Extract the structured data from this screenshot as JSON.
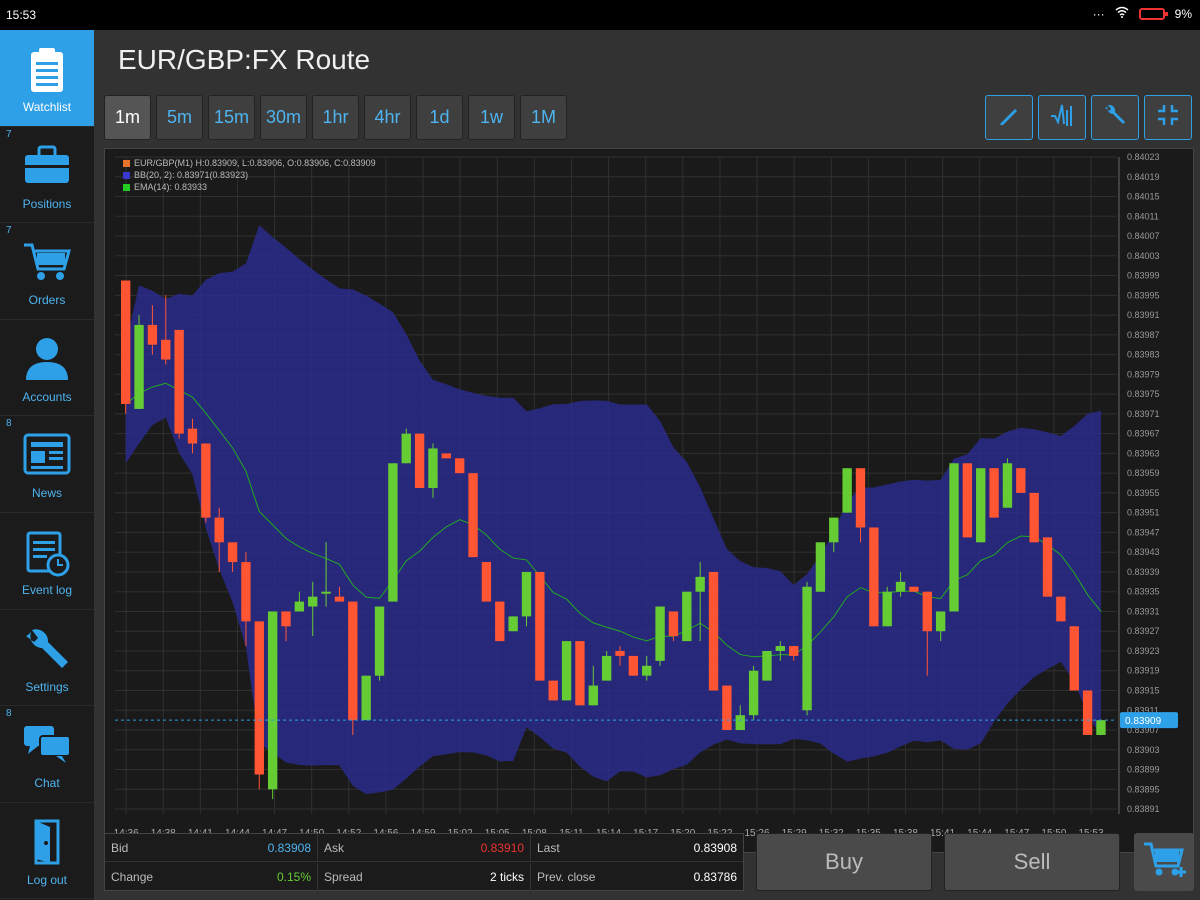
{
  "status_bar": {
    "time": "15:53",
    "battery": "9%"
  },
  "sidebar": {
    "items": [
      {
        "label": "Watchlist",
        "icon": "clipboard-icon",
        "badge": "",
        "active": true
      },
      {
        "label": "Positions",
        "icon": "briefcase-icon",
        "badge": "7",
        "active": false
      },
      {
        "label": "Orders",
        "icon": "cart-icon",
        "badge": "7",
        "active": false
      },
      {
        "label": "Accounts",
        "icon": "user-icon",
        "badge": "",
        "active": false
      },
      {
        "label": "News",
        "icon": "newspaper-icon",
        "badge": "8",
        "active": false
      },
      {
        "label": "Event log",
        "icon": "calendar-clock-icon",
        "badge": "",
        "active": false
      },
      {
        "label": "Settings",
        "icon": "wrench-icon",
        "badge": "",
        "active": false
      },
      {
        "label": "Chat",
        "icon": "chat-icon",
        "badge": "8",
        "active": false
      },
      {
        "label": "Log out",
        "icon": "logout-icon",
        "badge": "",
        "active": false
      }
    ]
  },
  "header": {
    "title": "EUR/GBP:FX Route"
  },
  "timeframes": [
    {
      "label": "1m",
      "active": true
    },
    {
      "label": "5m",
      "active": false
    },
    {
      "label": "15m",
      "active": false
    },
    {
      "label": "30m",
      "active": false
    },
    {
      "label": "1hr",
      "active": false
    },
    {
      "label": "4hr",
      "active": false
    },
    {
      "label": "1d",
      "active": false
    },
    {
      "label": "1w",
      "active": false
    },
    {
      "label": "1M",
      "active": false
    }
  ],
  "tools": [
    "pencil-icon",
    "indicator-icon",
    "wrench-icon",
    "fullscreen-icon"
  ],
  "chart_data": {
    "type": "candlestick",
    "legend": [
      {
        "text": "EUR/GBP(M1) H:0.83909, L:0.83906, O:0.83906, C:0.83909",
        "color": "#e8732a"
      },
      {
        "text": "BB(20, 2): 0.83971(0.83923)",
        "color": "#3838d0"
      },
      {
        "text": "EMA(14): 0.83933",
        "color": "#22cc22"
      }
    ],
    "ylim": [
      0.8389,
      0.84023
    ],
    "y_ticks": [
      "0.84023",
      "0.84019",
      "0.84015",
      "0.84011",
      "0.84007",
      "0.84003",
      "0.83999",
      "0.83995",
      "0.83991",
      "0.83987",
      "0.83983",
      "0.83979",
      "0.83975",
      "0.83971",
      "0.83967",
      "0.83963",
      "0.83959",
      "0.83955",
      "0.83951",
      "0.83947",
      "0.83943",
      "0.83939",
      "0.83935",
      "0.83931",
      "0.83927",
      "0.83923",
      "0.83919",
      "0.83915",
      "0.83911",
      "0.83907",
      "0.83903",
      "0.83899",
      "0.83895",
      "0.83891"
    ],
    "x_ticks": [
      "14:36",
      "14:38",
      "14:41",
      "14:44",
      "14:47",
      "14:50",
      "14:52",
      "14:56",
      "14:59",
      "15:02",
      "15:05",
      "15:08",
      "15:11",
      "15:14",
      "15:17",
      "15:20",
      "15:22",
      "15:26",
      "15:29",
      "15:32",
      "15:35",
      "15:38",
      "15:41",
      "15:44",
      "15:47",
      "15:50",
      "15:53"
    ],
    "last_price": "0.83909",
    "candles": [
      [
        0.83998,
        0.83998,
        0.83971,
        0.83973
      ],
      [
        0.83972,
        0.83991,
        0.83972,
        0.83989
      ],
      [
        0.83989,
        0.83993,
        0.83983,
        0.83985
      ],
      [
        0.83986,
        0.83995,
        0.83981,
        0.83982
      ],
      [
        0.83988,
        0.83988,
        0.83966,
        0.83967
      ],
      [
        0.83968,
        0.8397,
        0.83963,
        0.83965
      ],
      [
        0.83965,
        0.83965,
        0.83949,
        0.8395
      ],
      [
        0.8395,
        0.83952,
        0.83939,
        0.83945
      ],
      [
        0.83945,
        0.83945,
        0.83939,
        0.83941
      ],
      [
        0.83941,
        0.83943,
        0.83924,
        0.83929
      ],
      [
        0.83929,
        0.83929,
        0.83895,
        0.83898
      ],
      [
        0.83895,
        0.83931,
        0.83893,
        0.83931
      ],
      [
        0.83931,
        0.83931,
        0.83925,
        0.83928
      ],
      [
        0.83931,
        0.83935,
        0.83931,
        0.83933
      ],
      [
        0.83932,
        0.83937,
        0.83926,
        0.83934
      ],
      [
        0.83935,
        0.83945,
        0.83932,
        0.83935
      ],
      [
        0.83934,
        0.83936,
        0.83933,
        0.83933
      ],
      [
        0.83933,
        0.83933,
        0.83906,
        0.83909
      ],
      [
        0.83909,
        0.83918,
        0.83909,
        0.83918
      ],
      [
        0.83918,
        0.83932,
        0.83917,
        0.83932
      ],
      [
        0.83933,
        0.83961,
        0.83933,
        0.83961
      ],
      [
        0.83961,
        0.83968,
        0.83961,
        0.83967
      ],
      [
        0.83967,
        0.83965,
        0.83956,
        0.83956
      ],
      [
        0.83956,
        0.83965,
        0.83954,
        0.83964
      ],
      [
        0.83963,
        0.83963,
        0.83963,
        0.83962
      ],
      [
        0.83962,
        0.83962,
        0.83959,
        0.83959
      ],
      [
        0.83959,
        0.83959,
        0.83942,
        0.83942
      ],
      [
        0.83941,
        0.83941,
        0.83933,
        0.83933
      ],
      [
        0.83933,
        0.83933,
        0.83925,
        0.83925
      ],
      [
        0.83927,
        0.8393,
        0.83927,
        0.8393
      ],
      [
        0.8393,
        0.83939,
        0.83928,
        0.83939
      ],
      [
        0.83939,
        0.83939,
        0.83917,
        0.83917
      ],
      [
        0.83917,
        0.83917,
        0.83913,
        0.83913
      ],
      [
        0.83913,
        0.83925,
        0.83913,
        0.83925
      ],
      [
        0.83925,
        0.83925,
        0.83912,
        0.83912
      ],
      [
        0.83912,
        0.8392,
        0.83912,
        0.83916
      ],
      [
        0.83917,
        0.83923,
        0.83917,
        0.83922
      ],
      [
        0.83923,
        0.83924,
        0.8392,
        0.83922
      ],
      [
        0.83922,
        0.83922,
        0.83918,
        0.83918
      ],
      [
        0.83918,
        0.83922,
        0.83917,
        0.8392
      ],
      [
        0.83921,
        0.8393,
        0.8392,
        0.83932
      ],
      [
        0.83931,
        0.83931,
        0.83925,
        0.83926
      ],
      [
        0.83925,
        0.83935,
        0.83925,
        0.83935
      ],
      [
        0.83935,
        0.83941,
        0.83925,
        0.83938
      ],
      [
        0.83939,
        0.83939,
        0.83915,
        0.83915
      ],
      [
        0.83916,
        0.83916,
        0.83907,
        0.83907
      ],
      [
        0.83907,
        0.83912,
        0.83907,
        0.8391
      ],
      [
        0.8391,
        0.8392,
        0.83909,
        0.83919
      ],
      [
        0.83917,
        0.83923,
        0.83917,
        0.83923
      ],
      [
        0.83923,
        0.83925,
        0.83921,
        0.83924
      ],
      [
        0.83924,
        0.83924,
        0.83921,
        0.83922
      ],
      [
        0.83911,
        0.83937,
        0.8391,
        0.83936
      ],
      [
        0.83935,
        0.83945,
        0.83935,
        0.83945
      ],
      [
        0.83945,
        0.8395,
        0.83943,
        0.8395
      ],
      [
        0.83951,
        0.8396,
        0.83951,
        0.8396
      ],
      [
        0.8396,
        0.8396,
        0.83945,
        0.83948
      ],
      [
        0.83948,
        0.83948,
        0.83928,
        0.83928
      ],
      [
        0.83928,
        0.83936,
        0.83928,
        0.83935
      ],
      [
        0.83935,
        0.83939,
        0.83934,
        0.83937
      ],
      [
        0.83936,
        0.83936,
        0.83935,
        0.83935
      ],
      [
        0.83935,
        0.83935,
        0.83918,
        0.83927
      ],
      [
        0.83927,
        0.83931,
        0.83925,
        0.83931
      ],
      [
        0.83931,
        0.83961,
        0.83931,
        0.83961
      ],
      [
        0.83961,
        0.83961,
        0.83946,
        0.83946
      ],
      [
        0.83945,
        0.8396,
        0.83945,
        0.8396
      ],
      [
        0.8396,
        0.8396,
        0.8395,
        0.8395
      ],
      [
        0.83952,
        0.83962,
        0.83952,
        0.83961
      ],
      [
        0.8396,
        0.8396,
        0.83955,
        0.83955
      ],
      [
        0.83955,
        0.83955,
        0.83945,
        0.83945
      ],
      [
        0.83946,
        0.83946,
        0.83934,
        0.83934
      ],
      [
        0.83934,
        0.83934,
        0.83929,
        0.83929
      ],
      [
        0.83928,
        0.83928,
        0.83915,
        0.83915
      ],
      [
        0.83915,
        0.83915,
        0.83906,
        0.83906
      ],
      [
        0.83906,
        0.83909,
        0.83906,
        0.83909
      ]
    ]
  },
  "quote": {
    "bid_label": "Bid",
    "bid_value": "0.83908",
    "ask_label": "Ask",
    "ask_value": "0.83910",
    "last_label": "Last",
    "last_value": "0.83908",
    "change_label": "Change",
    "change_value": "0.15%",
    "spread_label": "Spread",
    "spread_value": "2 ticks",
    "prev_label": "Prev. close",
    "prev_value": "0.83786"
  },
  "actions": {
    "buy": "Buy",
    "sell": "Sell"
  },
  "colors": {
    "accent": "#2ea0e8",
    "up": "#66cc33",
    "down": "#ff5533",
    "band": "#2c2c8c"
  }
}
